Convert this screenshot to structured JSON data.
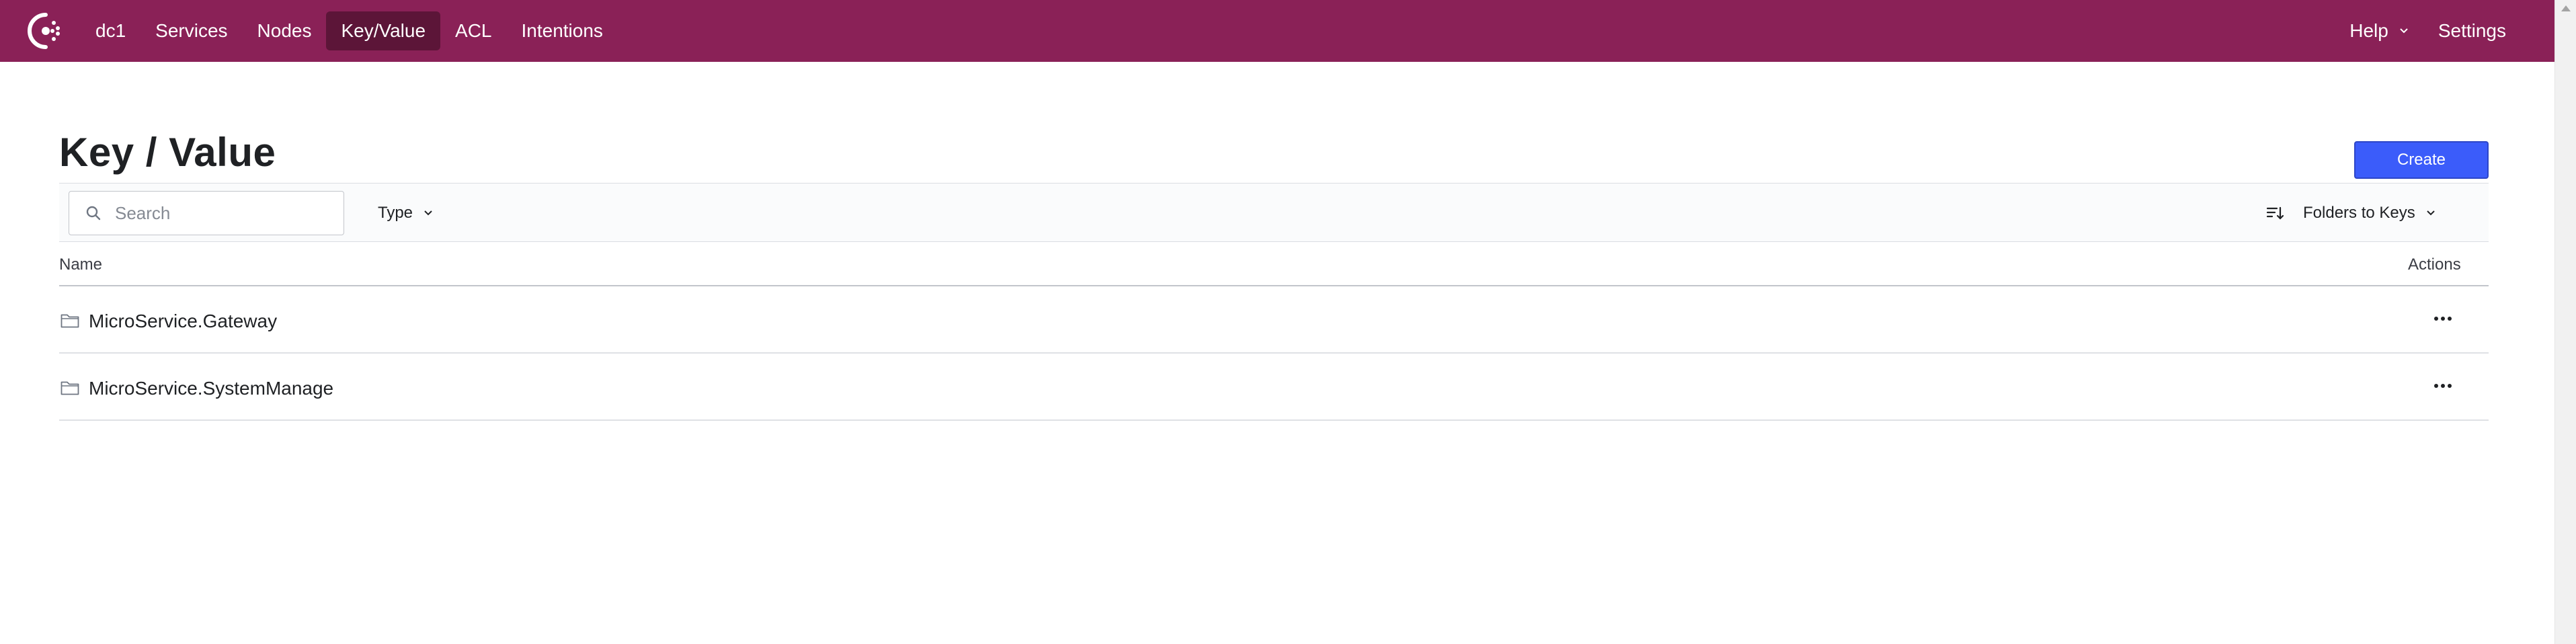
{
  "nav": {
    "logo": "consul-logo-icon",
    "items": [
      {
        "label": "dc1",
        "active": false
      },
      {
        "label": "Services",
        "active": false
      },
      {
        "label": "Nodes",
        "active": false
      },
      {
        "label": "Key/Value",
        "active": true
      },
      {
        "label": "ACL",
        "active": false
      },
      {
        "label": "Intentions",
        "active": false
      }
    ],
    "help_label": "Help",
    "settings_label": "Settings"
  },
  "page": {
    "title": "Key / Value",
    "create_label": "Create"
  },
  "toolbar": {
    "search_placeholder": "Search",
    "type_label": "Type",
    "sort_label": "Folders to Keys"
  },
  "table": {
    "columns": [
      "Name",
      "Actions"
    ],
    "rows": [
      {
        "name": "MicroService.Gateway",
        "icon": "folder-icon"
      },
      {
        "name": "MicroService.SystemManage",
        "icon": "folder-icon"
      }
    ]
  },
  "colors": {
    "nav_bg": "#8a2157",
    "nav_active": "#5c1538",
    "primary": "#3b5cfa"
  }
}
